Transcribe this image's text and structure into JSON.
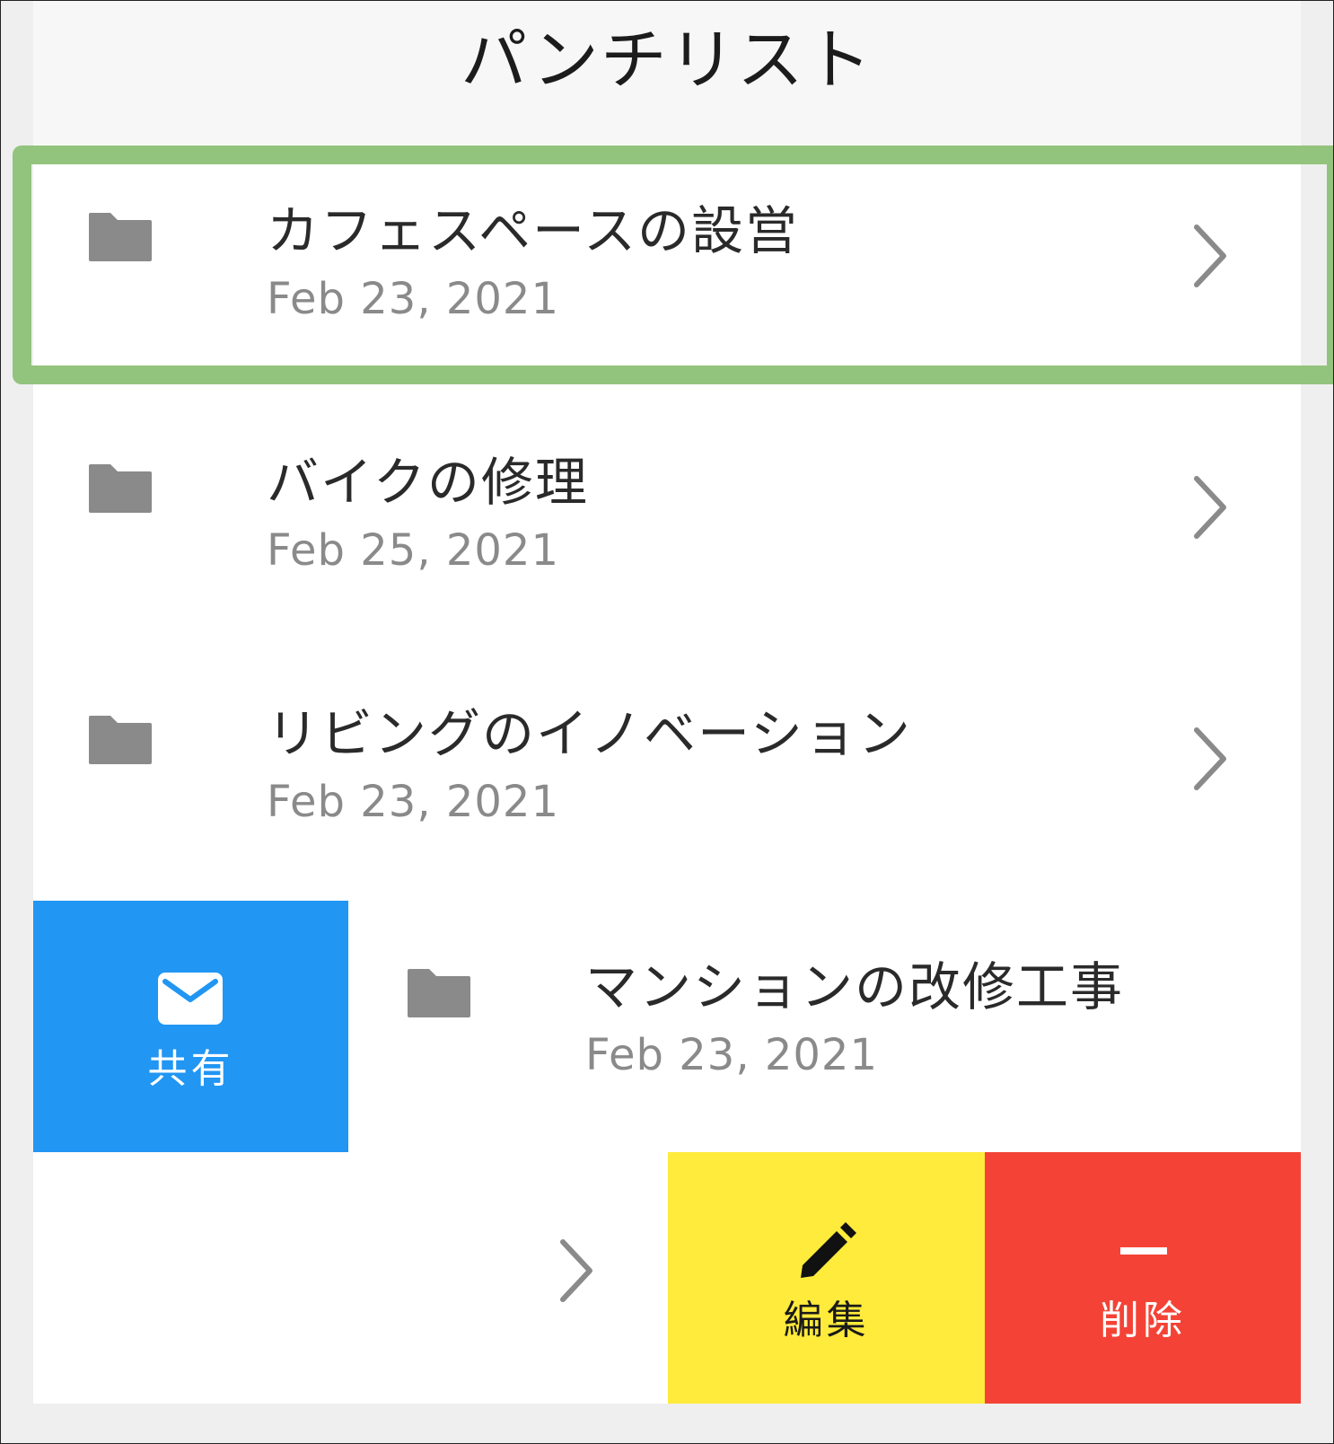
{
  "nav": {
    "title": "パンチリスト"
  },
  "rows": [
    {
      "title": "カフェスペースの設営",
      "date": "Feb 23, 2021"
    },
    {
      "title": "バイクの修理",
      "date": "Feb 25, 2021"
    },
    {
      "title": "リビングのイノベーション",
      "date": "Feb 23, 2021"
    },
    {
      "title": "マンションの改修工事",
      "date": "Feb 23, 2021"
    }
  ],
  "swipe_actions": {
    "share_label": "共有",
    "edit_label": "編集",
    "delete_label": "削除"
  },
  "colors": {
    "share": "#2196f3",
    "edit": "#ffeb3b",
    "delete": "#f44336",
    "highlight": "#93c47d",
    "folder_icon": "#8a8a8a",
    "chevron": "#8a8a8a"
  },
  "icons": {
    "row": "folder-icon",
    "disclosure": "chevron-right-icon",
    "share": "mail-icon",
    "edit": "pencil-icon",
    "delete": "minus-icon"
  }
}
